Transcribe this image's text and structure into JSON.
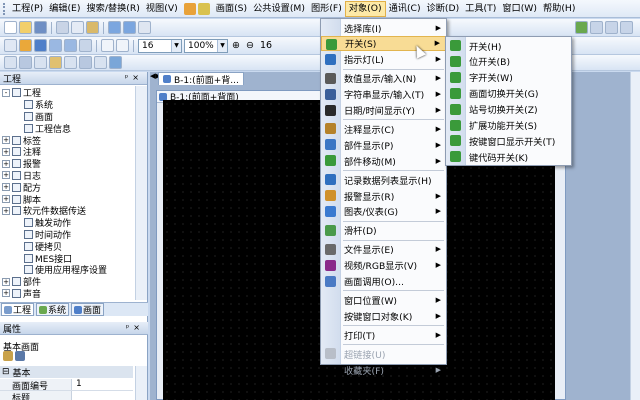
{
  "menubar": {
    "items": [
      "工程(P)",
      "编辑(E)",
      "搜索/替换(R)",
      "视图(V)",
      "画面(S)",
      "公共设置(M)",
      "图形(F)",
      "对象(O)",
      "通讯(C)",
      "诊断(D)",
      "工具(T)",
      "窗口(W)",
      "帮助(H)"
    ],
    "active_index": 7
  },
  "toolbar2": {
    "font_size": "16",
    "zoom": "100%",
    "font_size2": "16"
  },
  "left_panel": {
    "title": "工程",
    "tree": [
      {
        "label": "工程",
        "level": 0,
        "expander": "-"
      },
      {
        "label": "系统",
        "level": 1,
        "expander": ""
      },
      {
        "label": "画面",
        "level": 1,
        "expander": ""
      },
      {
        "label": "工程信息",
        "level": 1,
        "expander": ""
      },
      {
        "label": "标签",
        "level": 0,
        "expander": "+"
      },
      {
        "label": "注释",
        "level": 0,
        "expander": "+"
      },
      {
        "label": "报警",
        "level": 0,
        "expander": "+"
      },
      {
        "label": "日志",
        "level": 0,
        "expander": "+"
      },
      {
        "label": "配方",
        "level": 0,
        "expander": "+"
      },
      {
        "label": "脚本",
        "level": 0,
        "expander": "+"
      },
      {
        "label": "软元件数据传送",
        "level": 0,
        "expander": "+"
      },
      {
        "label": "触发动作",
        "level": 1,
        "expander": ""
      },
      {
        "label": "时间动作",
        "level": 1,
        "expander": ""
      },
      {
        "label": "硬拷贝",
        "level": 1,
        "expander": ""
      },
      {
        "label": "MES接口",
        "level": 1,
        "expander": ""
      },
      {
        "label": "使用应用程序设置",
        "level": 1,
        "expander": ""
      },
      {
        "label": "部件",
        "level": 0,
        "expander": "+"
      },
      {
        "label": "声音",
        "level": 0,
        "expander": "+"
      }
    ],
    "tabs": [
      "工程",
      "系统",
      "画面"
    ]
  },
  "properties": {
    "title": "属性",
    "subtitle": "基本画面",
    "group": "基本",
    "rows": [
      {
        "key": "画面编号",
        "value": "1"
      },
      {
        "key": "标题",
        "value": ""
      }
    ]
  },
  "document": {
    "tab_label": "B-1:(前面+背...",
    "frame_title": "B-1:(前面+背面)"
  },
  "object_menu": {
    "items": [
      {
        "label": "选择库(I)",
        "arrow": true,
        "icon": "",
        "disabled": false,
        "sep_after": false
      },
      {
        "label": "开关(S)",
        "arrow": true,
        "icon": "#3a9a3a",
        "disabled": false,
        "sep_after": false,
        "highlight": true
      },
      {
        "label": "指示灯(L)",
        "arrow": true,
        "icon": "#2f6fbf",
        "disabled": false,
        "sep_after": true
      },
      {
        "label": "数值显示/输入(N)",
        "arrow": true,
        "icon": "#5a5a5a",
        "disabled": false,
        "sep_after": false
      },
      {
        "label": "字符串显示/输入(T)",
        "arrow": true,
        "icon": "#3b5f9a",
        "disabled": false,
        "sep_after": false
      },
      {
        "label": "日期/时间显示(Y)",
        "arrow": true,
        "icon": "#2a2a2a",
        "disabled": false,
        "sep_after": true
      },
      {
        "label": "注释显示(C)",
        "arrow": true,
        "icon": "#b5822a",
        "disabled": false,
        "sep_after": false
      },
      {
        "label": "部件显示(P)",
        "arrow": true,
        "icon": "#3b76c4",
        "disabled": false,
        "sep_after": false
      },
      {
        "label": "部件移动(M)",
        "arrow": true,
        "icon": "#3a9a3a",
        "disabled": false,
        "sep_after": true
      },
      {
        "label": "记录数据列表显示(H)",
        "arrow": false,
        "icon": "#2f6fbf",
        "disabled": false,
        "sep_after": false
      },
      {
        "label": "报警显示(R)",
        "arrow": true,
        "icon": "#d0912a",
        "disabled": false,
        "sep_after": false
      },
      {
        "label": "图表/仪表(G)",
        "arrow": true,
        "icon": "#3a7ad0",
        "disabled": false,
        "sep_after": true
      },
      {
        "label": "滑杆(D)",
        "arrow": false,
        "icon": "#4a9a4a",
        "disabled": false,
        "sep_after": true
      },
      {
        "label": "文件显示(E)",
        "arrow": true,
        "icon": "#6a6a6a",
        "disabled": false,
        "sep_after": false
      },
      {
        "label": "视频/RGB显示(V)",
        "arrow": true,
        "icon": "#8a2a8a",
        "disabled": false,
        "sep_after": false
      },
      {
        "label": "画面调用(O)...",
        "arrow": false,
        "icon": "#4a7ac4",
        "disabled": false,
        "sep_after": true
      },
      {
        "label": "窗口位置(W)",
        "arrow": true,
        "icon": "",
        "disabled": false,
        "sep_after": false
      },
      {
        "label": "按键窗口对象(K)",
        "arrow": true,
        "icon": "",
        "disabled": false,
        "sep_after": true
      },
      {
        "label": "打印(T)",
        "arrow": true,
        "icon": "",
        "disabled": false,
        "sep_after": true
      },
      {
        "label": "超链接(U)",
        "arrow": false,
        "icon": "#b8bec8",
        "disabled": true,
        "sep_after": false
      },
      {
        "label": "收藏夹(F)",
        "arrow": true,
        "icon": "",
        "disabled": true,
        "sep_after": false
      }
    ]
  },
  "switch_submenu": {
    "items": [
      {
        "label": "开关(H)",
        "icon": "#3a9a3a"
      },
      {
        "label": "位开关(B)",
        "icon": "#3a9a3a"
      },
      {
        "label": "字开关(W)",
        "icon": "#3a9a3a"
      },
      {
        "label": "画面切换开关(G)",
        "icon": "#3a9a3a"
      },
      {
        "label": "站号切换开关(Z)",
        "icon": "#3a9a3a"
      },
      {
        "label": "扩展功能开关(S)",
        "icon": "#3a9a3a"
      },
      {
        "label": "按键窗口显示开关(T)",
        "icon": "#3a9a3a"
      },
      {
        "label": "键代码开关(K)",
        "icon": "#3a9a3a"
      }
    ]
  }
}
